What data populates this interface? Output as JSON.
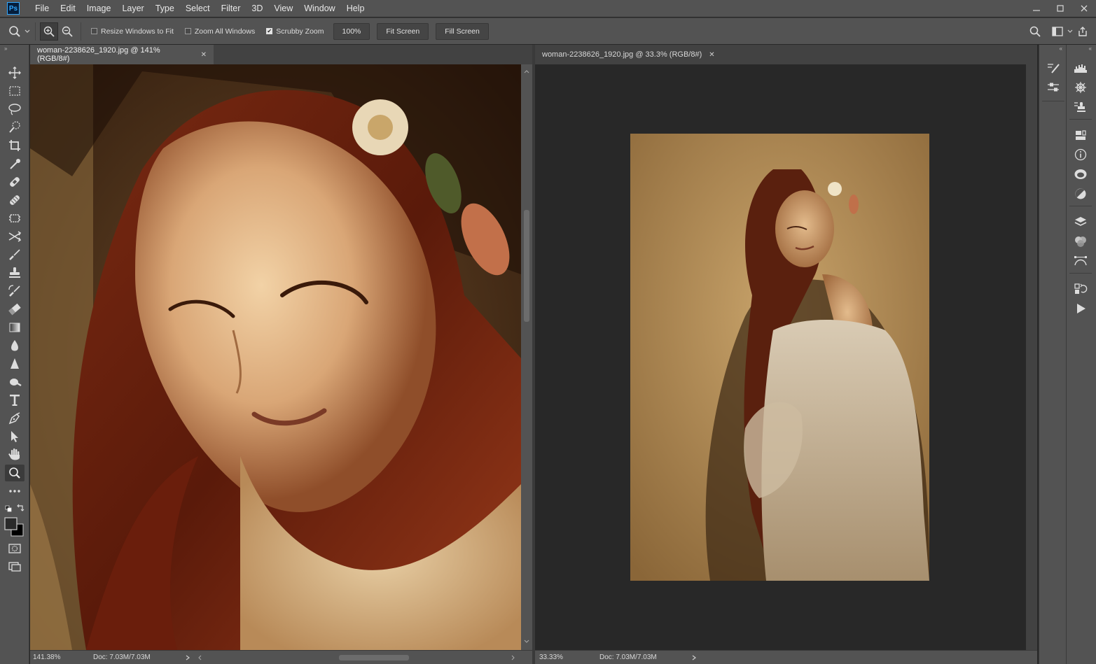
{
  "menu": {
    "logo": "Ps",
    "items": [
      "File",
      "Edit",
      "Image",
      "Layer",
      "Type",
      "Select",
      "Filter",
      "3D",
      "View",
      "Window",
      "Help"
    ]
  },
  "options": {
    "resize_windows": "Resize Windows to Fit",
    "zoom_all": "Zoom All Windows",
    "scrubby_zoom": "Scrubby Zoom",
    "btn_100": "100%",
    "fit_screen": "Fit Screen",
    "fill_screen": "Fill Screen",
    "resize_checked": false,
    "zoom_all_checked": false,
    "scrubby_checked": true
  },
  "left_doc": {
    "title": "woman-2238626_1920.jpg @ 141% (RGB/8#)",
    "zoom": "141.38%",
    "doc": "Doc: 7.03M/7.03M"
  },
  "right_doc": {
    "title": "woman-2238626_1920.jpg @ 33.3% (RGB/8#)",
    "zoom": "33.33%",
    "doc": "Doc: 7.03M/7.03M"
  },
  "tools": [
    "move-tool",
    "marquee-tool",
    "lasso-tool",
    "quick-select-tool",
    "crop-tool",
    "eyedropper-tool",
    "healing-brush-tool",
    "patch-tool",
    "frame-tool",
    "content-aware-move-tool",
    "brush-tool",
    "clone-stamp-tool",
    "history-brush-tool",
    "eraser-tool",
    "gradient-tool",
    "blur-tool",
    "sharpen-tool",
    "dodge-tool",
    "type-tool",
    "pen-tool",
    "path-selection-tool",
    "hand-tool",
    "zoom-tool",
    "edit-toolbar"
  ],
  "right_panels": [
    "brushes-icon",
    "histogram-icon",
    "adjustments-icon",
    "navigator-icon",
    "clone-source-icon",
    "libraries-icon",
    "info-icon",
    "creative-cloud-icon",
    "adjustment-icon",
    "layers-icon",
    "channels-icon",
    "paths-icon",
    "history-icon",
    "actions-icon"
  ]
}
